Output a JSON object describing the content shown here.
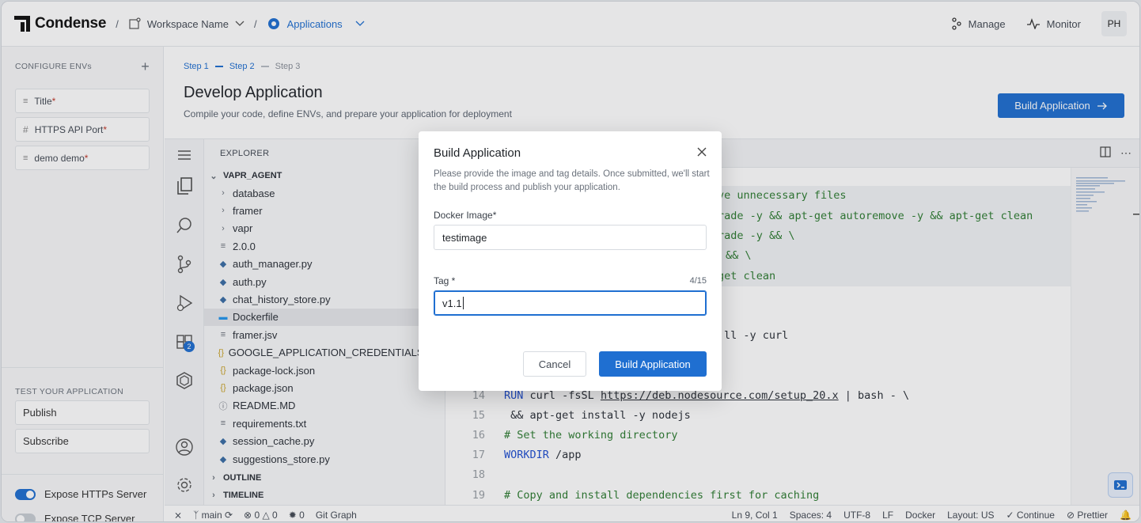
{
  "brand": {
    "name": "Condense"
  },
  "breadcrumb": {
    "sep": "/",
    "workspace": "Workspace Name",
    "app": "Applications"
  },
  "topnav": {
    "manage": "Manage",
    "monitor": "Monitor",
    "avatar": "PH"
  },
  "left": {
    "configure_title": "CONFIGURE ENVs",
    "envs": [
      {
        "label": "Title",
        "req": "*"
      },
      {
        "label": "HTTPS API Port",
        "req": "*"
      },
      {
        "label": "demo demo",
        "req": "*"
      }
    ],
    "test_title": "TEST YOUR APPLICATION",
    "tests": [
      "Publish",
      "Subscribe"
    ],
    "toggles": [
      {
        "label": "Expose HTTPs Server",
        "on": true
      },
      {
        "label": "Expose TCP Server",
        "on": false
      }
    ]
  },
  "main": {
    "steps": [
      "Step 1",
      "Step 2",
      "Step 3"
    ],
    "title": "Develop Application",
    "subtitle": "Compile your code, define ENVs, and prepare your application for deployment",
    "build_button": "Build Application"
  },
  "explorer": {
    "title": "EXPLORER",
    "root": "VAPR_AGENT",
    "items": [
      {
        "name": "database",
        "type": "folder"
      },
      {
        "name": "framer",
        "type": "folder"
      },
      {
        "name": "vapr",
        "type": "folder"
      },
      {
        "name": "2.0.0",
        "type": "file"
      },
      {
        "name": "auth_manager.py",
        "type": "py"
      },
      {
        "name": "auth.py",
        "type": "py"
      },
      {
        "name": "chat_history_store.py",
        "type": "py"
      },
      {
        "name": "Dockerfile",
        "type": "docker",
        "selected": true
      },
      {
        "name": "framer.jsv",
        "type": "file"
      },
      {
        "name": "GOOGLE_APPLICATION_CREDENTIALS.json",
        "type": "json"
      },
      {
        "name": "package-lock.json",
        "type": "json"
      },
      {
        "name": "package.json",
        "type": "json"
      },
      {
        "name": "README.MD",
        "type": "info"
      },
      {
        "name": "requirements.txt",
        "type": "file"
      },
      {
        "name": "session_cache.py",
        "type": "py"
      },
      {
        "name": "suggestions_store.py",
        "type": "py"
      }
    ],
    "outline": "OUTLINE",
    "timeline": "TIMELINE"
  },
  "code": {
    "visible_fragments": [
      {
        "text": "ve unnecessary files",
        "cls": "c-comment"
      },
      {
        "text": "rade -y && apt-get autoremove -y && apt-get clean",
        "cls": "c-comment"
      },
      {
        "text": "rade -y && \\",
        "cls": "c-comment"
      },
      {
        "text": "&& \\",
        "cls": "c-comment"
      },
      {
        "text": "get clean",
        "cls": "c-comment"
      },
      {
        "text": "ll -y curl",
        "cls": "c-plain"
      }
    ],
    "lines": [
      {
        "num": "14",
        "kw": "RUN",
        "rest": " curl -fsSL ",
        "link": "https://deb.nodesource.com/setup_20.x",
        "tail": " | bash - \\"
      },
      {
        "num": "15",
        "kw": "",
        "rest": " && apt-get install -y nodejs",
        "link": "",
        "tail": ""
      },
      {
        "num": "16",
        "comment": "# Set the working directory"
      },
      {
        "num": "17",
        "kw": "WORKDIR",
        "rest": " /app",
        "link": "",
        "tail": ""
      },
      {
        "num": "18",
        "kw": "",
        "rest": "",
        "link": "",
        "tail": ""
      },
      {
        "num": "19",
        "comment": "# Copy and install dependencies first for caching"
      }
    ]
  },
  "status": {
    "branch": "main",
    "errors": "0",
    "warnings": "0",
    "ports": "0",
    "git_graph": "Git Graph",
    "position": "Ln 9, Col 1",
    "spaces": "Spaces: 4",
    "encoding": "UTF-8",
    "eol": "LF",
    "lang": "Docker",
    "layout": "Layout: US",
    "continue": "Continue",
    "prettier": "Prettier"
  },
  "modal": {
    "title": "Build Application",
    "description": "Please provide the image and tag details. Once submitted, we'll start the build process and publish your application.",
    "image_label": "Docker Image*",
    "image_value": "testimage",
    "tag_label": "Tag *",
    "tag_count": "4/15",
    "tag_value": "v1.1",
    "cancel": "Cancel",
    "submit": "Build Application"
  }
}
